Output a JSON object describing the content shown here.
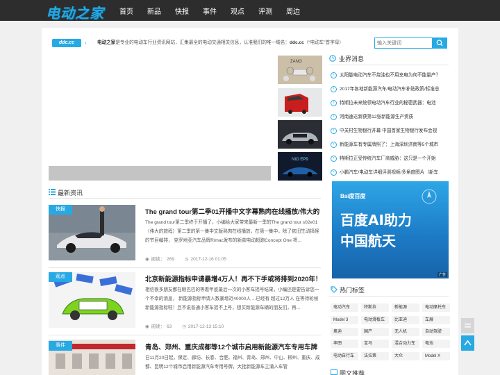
{
  "site": {
    "logo": "电动之家",
    "nav": [
      "首页",
      "新品",
      "快报",
      "事件",
      "观点",
      "评测",
      "周边"
    ]
  },
  "notice": {
    "badge": "ddc.cc",
    "site_name": "电动之家",
    "text_mid": "是专业的电动车行业资讯网站，汇集最全的电动交通相关信息，认准我们的唯一域名：",
    "domain": "ddc.cc",
    "text_end": "（“电动车”首字母）"
  },
  "search": {
    "placeholder": "输入关键词",
    "icon": "search-icon"
  },
  "latest": {
    "title": "最新资讯",
    "items": [
      {
        "tag": "快报",
        "title": "The grand tour第二季01开播中文字幕熟肉在线播放/伟大的",
        "summary": "The grand tour第二季终于开播了，小编给大家带来最新一季的The grand tour s02e01 （伟大的旅程）第二季的第一集中文版熟肉在线播放，在第一集中，除了依旧生动搞怪的节目编排， 克罗地亚汽车品牌Rimac发布的新款电动超跑Concept One 将...",
        "views_label": "阅读：",
        "views": "269",
        "date": "2017-12-16 01:05"
      },
      {
        "tag": "观点",
        "title": "北京新能源指标申请暴增4万人！再不下手或将排到2020年！",
        "summary": "相信很多朋友都在眼巴巴的等着年底最后一次的小客车摇号结果，小编还是要告诉您一个不幸的消息， 新能源指标申请人数暴增近40000人 ...已经有 超过12万人 在等待轮候新能源指标啦！且不说普通小客车摇不上号，想买新能源车辆的朋友们，再...",
        "views_label": "阅读：",
        "views": "63",
        "date": "2017-12-13 15:10"
      },
      {
        "tag": "事件",
        "title": "青岛、郑州、重庆成都等12个城市启用新能源汽车专用车牌",
        "summary": "日11月20日起，保定、廊坊、长春、合肥、福州、青岛、郑州、中山、柳州、重庆、成都、昆明12个城市启用新能源汽车专用号牌，大批新能源车主涌入车管"
      }
    ]
  },
  "industry": {
    "title": "业界消息",
    "items": [
      "太阳能电动汽车不烧油也不用充电为何不能量产？",
      "2017年各地新能源汽车/电动汽车补贴政策/标准总",
      "特斯拉未来统领电动汽车行业的秘密武器：电池",
      "河南速达新获第12张新能源生产资质",
      "中关村生物银行开幕 中国首家生物银行发布会视",
      "新能源车有专属牌照了：上海深圳济南等5个城市",
      "特斯拉正受传统汽车厂商威胁：这只是一个开始",
      "小鹏汽车/电动车详细评测视频/多角度图片（新车"
    ]
  },
  "ad": {
    "brand": "Bai度百度",
    "line1": "百度AI助力",
    "line2": "中国航天",
    "label": "广告"
  },
  "hot_tags": {
    "title": "热门标签",
    "tags": [
      "电动汽车",
      "特斯拉",
      "新能源",
      "电动摩托车",
      "Model 3",
      "电动滑板车",
      "比亚迪",
      "车展",
      "奥迪",
      "国产",
      "无人机",
      "自动驾驶",
      "丰田",
      "宝马",
      "混合动力车",
      "电池",
      "电动自行车",
      "法拉第",
      "大众",
      "Model X"
    ]
  },
  "image_recommend": {
    "title": "图文推荐"
  },
  "colors": {
    "accent": "#27a9e3",
    "nav_bg": "#2d2d2d",
    "page_bg": "#f0f0f0"
  }
}
